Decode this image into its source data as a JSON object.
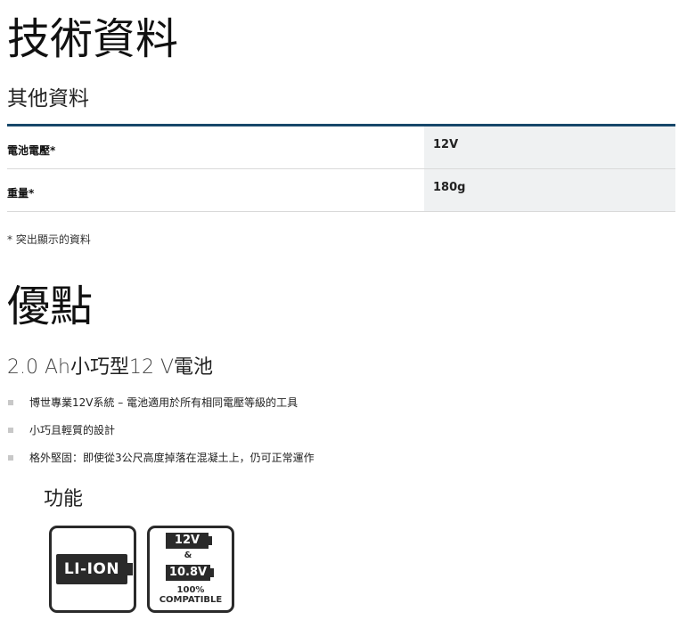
{
  "technical": {
    "title": "技術資料",
    "subtitle": "其他資料",
    "rows": [
      {
        "label": "電池電壓*",
        "value": "12V"
      },
      {
        "label": "重量*",
        "value": "180g"
      }
    ],
    "footnote": "* 突出顯示的資料"
  },
  "advantages": {
    "title": "優點",
    "subtitle_part1": "2.0 Ah",
    "subtitle_part2": "小巧型",
    "subtitle_part3": "12 V",
    "subtitle_part4": "電池",
    "bullets": [
      "博世專業12V系統 – 電池適用於所有相同電壓等級的工具",
      "小巧且輕質的設計",
      "格外堅固：即使從3公尺高度掉落在混凝土上，仍可正常運作"
    ]
  },
  "features": {
    "title": "功能",
    "liion_label": "LI-ION",
    "compat_voltage_a": "12V",
    "compat_amp": "&",
    "compat_voltage_b": "10.8V",
    "compat_percent": "100%",
    "compat_word": "COMPATIBLE"
  },
  "colors": {
    "table_rule": "#17476a",
    "value_bg": "#eff1f2",
    "badge_dark": "#2a2a2a"
  },
  "icons": {
    "liion_badge": "li-ion-battery-icon",
    "compat_badge": "compatible-battery-icon",
    "bullet": "square-bullet-icon"
  }
}
